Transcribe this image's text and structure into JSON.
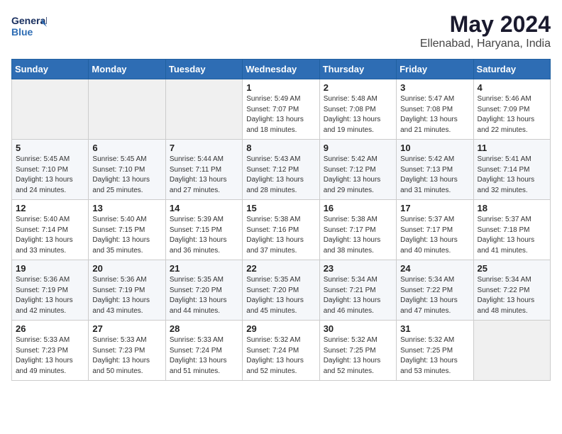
{
  "header": {
    "logo_line1": "General",
    "logo_line2": "Blue",
    "month_year": "May 2024",
    "location": "Ellenabad, Haryana, India"
  },
  "weekdays": [
    "Sunday",
    "Monday",
    "Tuesday",
    "Wednesday",
    "Thursday",
    "Friday",
    "Saturday"
  ],
  "weeks": [
    [
      {
        "day": "",
        "info": ""
      },
      {
        "day": "",
        "info": ""
      },
      {
        "day": "",
        "info": ""
      },
      {
        "day": "1",
        "info": "Sunrise: 5:49 AM\nSunset: 7:07 PM\nDaylight: 13 hours\nand 18 minutes."
      },
      {
        "day": "2",
        "info": "Sunrise: 5:48 AM\nSunset: 7:08 PM\nDaylight: 13 hours\nand 19 minutes."
      },
      {
        "day": "3",
        "info": "Sunrise: 5:47 AM\nSunset: 7:08 PM\nDaylight: 13 hours\nand 21 minutes."
      },
      {
        "day": "4",
        "info": "Sunrise: 5:46 AM\nSunset: 7:09 PM\nDaylight: 13 hours\nand 22 minutes."
      }
    ],
    [
      {
        "day": "5",
        "info": "Sunrise: 5:45 AM\nSunset: 7:10 PM\nDaylight: 13 hours\nand 24 minutes."
      },
      {
        "day": "6",
        "info": "Sunrise: 5:45 AM\nSunset: 7:10 PM\nDaylight: 13 hours\nand 25 minutes."
      },
      {
        "day": "7",
        "info": "Sunrise: 5:44 AM\nSunset: 7:11 PM\nDaylight: 13 hours\nand 27 minutes."
      },
      {
        "day": "8",
        "info": "Sunrise: 5:43 AM\nSunset: 7:12 PM\nDaylight: 13 hours\nand 28 minutes."
      },
      {
        "day": "9",
        "info": "Sunrise: 5:42 AM\nSunset: 7:12 PM\nDaylight: 13 hours\nand 29 minutes."
      },
      {
        "day": "10",
        "info": "Sunrise: 5:42 AM\nSunset: 7:13 PM\nDaylight: 13 hours\nand 31 minutes."
      },
      {
        "day": "11",
        "info": "Sunrise: 5:41 AM\nSunset: 7:14 PM\nDaylight: 13 hours\nand 32 minutes."
      }
    ],
    [
      {
        "day": "12",
        "info": "Sunrise: 5:40 AM\nSunset: 7:14 PM\nDaylight: 13 hours\nand 33 minutes."
      },
      {
        "day": "13",
        "info": "Sunrise: 5:40 AM\nSunset: 7:15 PM\nDaylight: 13 hours\nand 35 minutes."
      },
      {
        "day": "14",
        "info": "Sunrise: 5:39 AM\nSunset: 7:15 PM\nDaylight: 13 hours\nand 36 minutes."
      },
      {
        "day": "15",
        "info": "Sunrise: 5:38 AM\nSunset: 7:16 PM\nDaylight: 13 hours\nand 37 minutes."
      },
      {
        "day": "16",
        "info": "Sunrise: 5:38 AM\nSunset: 7:17 PM\nDaylight: 13 hours\nand 38 minutes."
      },
      {
        "day": "17",
        "info": "Sunrise: 5:37 AM\nSunset: 7:17 PM\nDaylight: 13 hours\nand 40 minutes."
      },
      {
        "day": "18",
        "info": "Sunrise: 5:37 AM\nSunset: 7:18 PM\nDaylight: 13 hours\nand 41 minutes."
      }
    ],
    [
      {
        "day": "19",
        "info": "Sunrise: 5:36 AM\nSunset: 7:19 PM\nDaylight: 13 hours\nand 42 minutes."
      },
      {
        "day": "20",
        "info": "Sunrise: 5:36 AM\nSunset: 7:19 PM\nDaylight: 13 hours\nand 43 minutes."
      },
      {
        "day": "21",
        "info": "Sunrise: 5:35 AM\nSunset: 7:20 PM\nDaylight: 13 hours\nand 44 minutes."
      },
      {
        "day": "22",
        "info": "Sunrise: 5:35 AM\nSunset: 7:20 PM\nDaylight: 13 hours\nand 45 minutes."
      },
      {
        "day": "23",
        "info": "Sunrise: 5:34 AM\nSunset: 7:21 PM\nDaylight: 13 hours\nand 46 minutes."
      },
      {
        "day": "24",
        "info": "Sunrise: 5:34 AM\nSunset: 7:22 PM\nDaylight: 13 hours\nand 47 minutes."
      },
      {
        "day": "25",
        "info": "Sunrise: 5:34 AM\nSunset: 7:22 PM\nDaylight: 13 hours\nand 48 minutes."
      }
    ],
    [
      {
        "day": "26",
        "info": "Sunrise: 5:33 AM\nSunset: 7:23 PM\nDaylight: 13 hours\nand 49 minutes."
      },
      {
        "day": "27",
        "info": "Sunrise: 5:33 AM\nSunset: 7:23 PM\nDaylight: 13 hours\nand 50 minutes."
      },
      {
        "day": "28",
        "info": "Sunrise: 5:33 AM\nSunset: 7:24 PM\nDaylight: 13 hours\nand 51 minutes."
      },
      {
        "day": "29",
        "info": "Sunrise: 5:32 AM\nSunset: 7:24 PM\nDaylight: 13 hours\nand 52 minutes."
      },
      {
        "day": "30",
        "info": "Sunrise: 5:32 AM\nSunset: 7:25 PM\nDaylight: 13 hours\nand 52 minutes."
      },
      {
        "day": "31",
        "info": "Sunrise: 5:32 AM\nSunset: 7:25 PM\nDaylight: 13 hours\nand 53 minutes."
      },
      {
        "day": "",
        "info": ""
      }
    ]
  ]
}
